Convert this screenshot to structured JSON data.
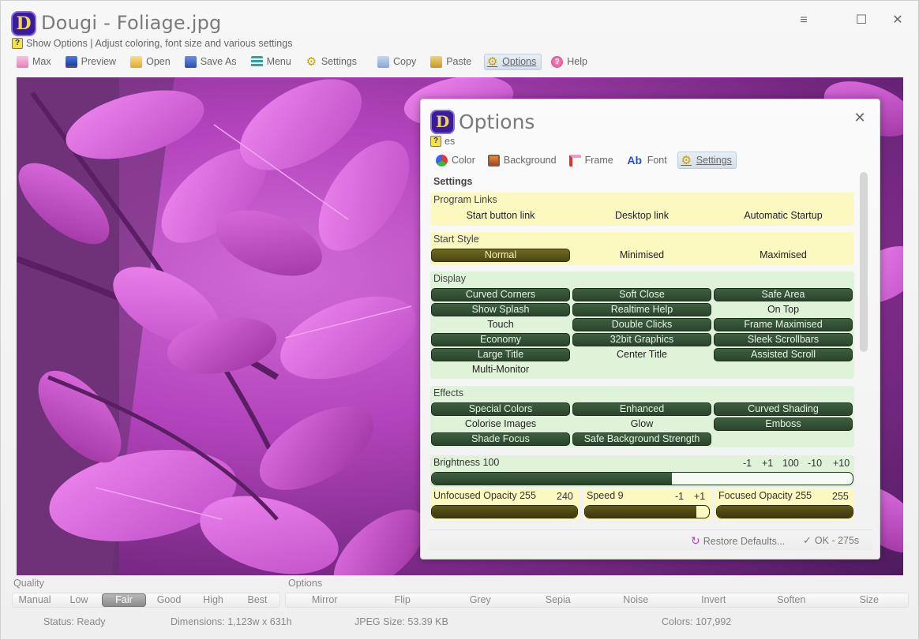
{
  "window": {
    "title": "Dougi - Foliage.jpg",
    "logo_letter": "D",
    "help_text": "Show Options | Adjust coloring, font size and various settings",
    "help_icon": "?",
    "controls": {
      "menu": "≡",
      "maximize": "☐",
      "close": "✕"
    }
  },
  "toolbar": {
    "items": [
      {
        "label": "Max",
        "icon": "max-icon"
      },
      {
        "label": "Preview",
        "icon": "monitor-icon"
      },
      {
        "label": "Open",
        "icon": "folder-icon"
      },
      {
        "label": "Save As",
        "icon": "floppy-icon"
      },
      {
        "label": "Menu",
        "icon": "menu-icon"
      },
      {
        "label": "Settings",
        "icon": "gear-icon"
      },
      {
        "label": "Copy",
        "icon": "copy-icon"
      },
      {
        "label": "Paste",
        "icon": "paste-icon"
      },
      {
        "label": "Options",
        "icon": "gear-icon",
        "active": true
      },
      {
        "label": "Help",
        "icon": "help-icon"
      }
    ]
  },
  "dialog": {
    "title": "Options",
    "logo_letter": "D",
    "help_text": "es",
    "close": "✕",
    "tabs": [
      "Color",
      "Background",
      "Frame",
      "Font",
      "Settings"
    ],
    "active_tab": "Settings",
    "section_title": "Settings",
    "program_links": {
      "title": "Program Links",
      "options": [
        "Start button link",
        "Desktop link",
        "Automatic Startup"
      ]
    },
    "start_style": {
      "title": "Start Style",
      "options": [
        "Normal",
        "Minimised",
        "Maximised"
      ]
    },
    "display": {
      "title": "Display",
      "options": [
        "Curved Corners",
        "Soft Close",
        "Safe Area",
        "Show Splash",
        "Realtime Help",
        "On Top",
        "Touch",
        "Double Clicks",
        "Frame Maximised",
        "Economy",
        "32bit Graphics",
        "Sleek Scrollbars",
        "Large Title",
        "Center Title",
        "Assisted Scroll",
        "Multi-Monitor"
      ]
    },
    "effects": {
      "title": "Effects",
      "options": [
        "Special Colors",
        "Enhanced",
        "Curved Shading",
        "Colorise Images",
        "Glow",
        "Emboss",
        "Shade Focus",
        "Safe Background Strength"
      ]
    },
    "brightness": {
      "label": "Brightness 100",
      "steps": [
        "-1",
        "+1",
        "100",
        "-10",
        "+10"
      ],
      "level": 0.57
    },
    "unfocused": {
      "label": "Unfocused Opacity 255",
      "value": "240",
      "level": 1.0
    },
    "speed": {
      "label": "Speed 9",
      "steps": [
        "-1",
        "+1"
      ],
      "level": 0.9
    },
    "focused": {
      "label": "Focused Opacity 255",
      "value": "255",
      "level": 1.0
    },
    "footer": {
      "restore": "Restore Defaults...",
      "ok": "OK - 275s"
    }
  },
  "quality": {
    "label": "Quality",
    "options": [
      "Manual",
      "Low",
      "Fair",
      "Good",
      "High",
      "Best"
    ],
    "selected": "Fair"
  },
  "options_bar": {
    "label": "Options",
    "options": [
      "Mirror",
      "Flip",
      "Grey",
      "Sepia",
      "Noise",
      "Invert",
      "Soften",
      "Size"
    ]
  },
  "status": {
    "status": "Status: Ready",
    "dimensions": "Dimensions: 1,123w x 631h",
    "size": "JPEG Size: 53.39 KB",
    "colors": "Colors: 107,992"
  },
  "colors": {
    "accent_green": "#2b432c",
    "accent_olive": "#4c4712",
    "yellow_panel": "#fbf8c0",
    "green_panel": "#dff3d9"
  }
}
